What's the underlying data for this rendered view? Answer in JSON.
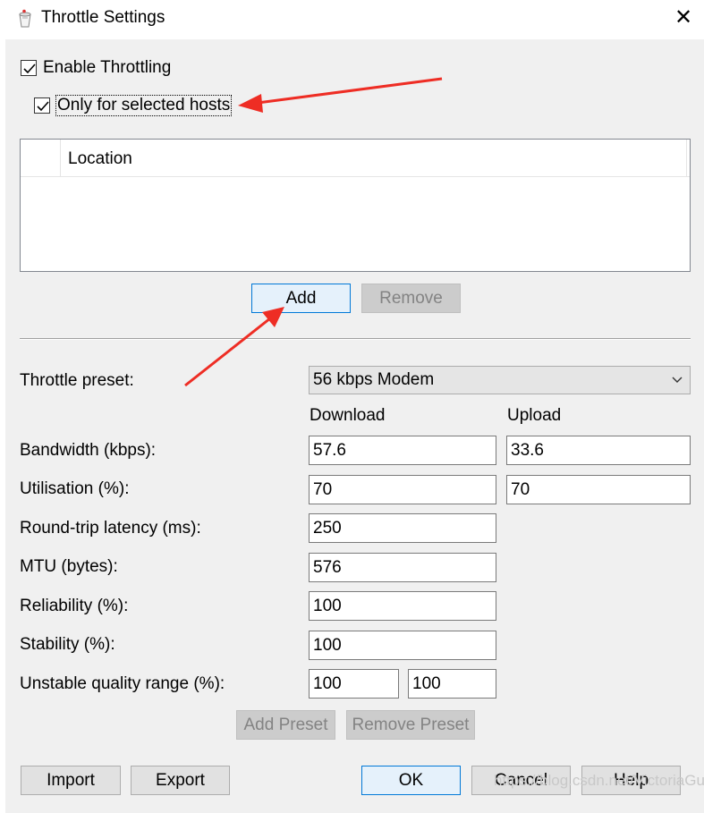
{
  "window": {
    "title": "Throttle Settings",
    "close_glyph": "✕"
  },
  "options": {
    "enable_throttling": {
      "label": "Enable Throttling",
      "checked": true
    },
    "selected_hosts": {
      "label": "Only for selected hosts",
      "checked": true
    }
  },
  "hosts_list": {
    "columns": [
      "Location"
    ],
    "rows": []
  },
  "hosts_buttons": {
    "add": "Add",
    "remove": "Remove"
  },
  "preset": {
    "label": "Throttle preset:",
    "value": "56 kbps Modem"
  },
  "columns": {
    "download": "Download",
    "upload": "Upload"
  },
  "settings": {
    "bandwidth": {
      "label": "Bandwidth (kbps):",
      "download": "57.6",
      "upload": "33.6"
    },
    "utilisation": {
      "label": "Utilisation (%):",
      "download": "70",
      "upload": "70"
    },
    "latency": {
      "label": "Round-trip latency (ms):",
      "value": "250"
    },
    "mtu": {
      "label": "MTU (bytes):",
      "value": "576"
    },
    "reliability": {
      "label": "Reliability (%):",
      "value": "100"
    },
    "stability": {
      "label": "Stability (%):",
      "value": "100"
    },
    "unstable_range": {
      "label": "Unstable quality range (%):",
      "min": "100",
      "max": "100"
    }
  },
  "preset_buttons": {
    "add": "Add Preset",
    "remove": "Remove Preset"
  },
  "footer": {
    "import": "Import",
    "export": "Export",
    "ok": "OK",
    "cancel": "Cancel",
    "help": "Help"
  },
  "watermark": "https://blog.csdn.net/VictoriaGu",
  "colors": {
    "annotation_arrow": "#ee2d24",
    "default_button_border": "#0078d7",
    "dialog_background": "#f0f0f0"
  }
}
